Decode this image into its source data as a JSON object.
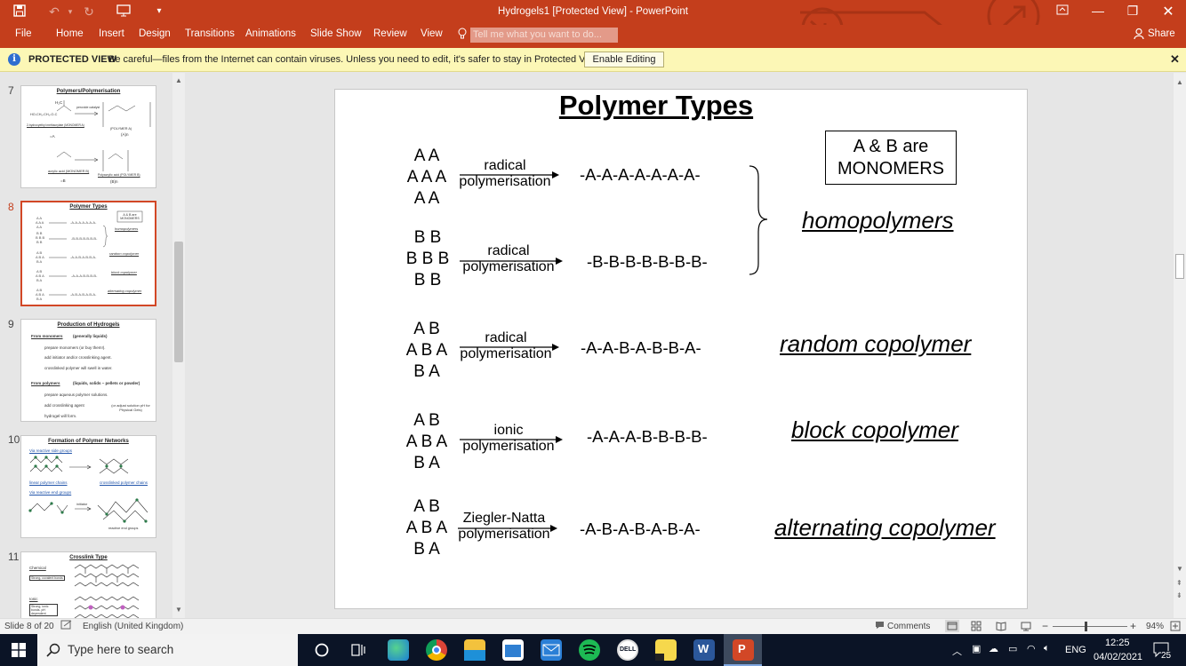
{
  "window": {
    "title": "Hydrogels1 [Protected View] - PowerPoint",
    "share_label": "Share"
  },
  "ribbon": {
    "tabs": [
      "File",
      "Home",
      "Insert",
      "Design",
      "Transitions",
      "Animations",
      "Slide Show",
      "Review",
      "View"
    ],
    "tell_me_placeholder": "Tell me what you want to do..."
  },
  "protected_view": {
    "title": "PROTECTED VIEW",
    "message": "Be careful—files from the Internet can contain viruses. Unless you need to edit, it's safer to stay in Protected View.",
    "enable_label": "Enable Editing"
  },
  "thumbnails": [
    {
      "number": "7",
      "title": "Polymers/Polymerisation"
    },
    {
      "number": "8",
      "title": "Polymer Types",
      "selected": true
    },
    {
      "number": "9",
      "title": "Production of Hydrogels"
    },
    {
      "number": "10",
      "title": "Formation of Polymer Networks"
    },
    {
      "number": "11",
      "title": "Crosslink Type"
    }
  ],
  "thumb_text": {
    "t7": [
      "H₂C",
      "peroxide catalyst",
      "HO-CH₂-CH₂-O-C",
      "2-hydroxyethyl methacrylate (MONOMER A)",
      "=A",
      "(POLYMER A)",
      "(A)n",
      "acrylic acid (MONOMER B)",
      "=B",
      "Polyacrylic acid (POLYMER B)",
      "(B)n"
    ],
    "t8": [
      "A & B are MONOMERS",
      "homopolymers",
      "random copolymer",
      "block copolymer",
      "alternating copolymer"
    ],
    "t9": [
      "From monomers",
      "(generally liquids)",
      "prepare monomers (or buy them!).",
      "add initiator and/or crosslinking agent.",
      "crosslinked polymer will swell in water.",
      "From polymers",
      "(liquids, solids – pellets or powder)",
      "prepare aqueous polymer solutions.",
      "add crosslinking agent",
      "hydrogel will form.",
      "(or adjust solution pH for Physical Gels)"
    ],
    "t10": [
      "Via reactive side groups",
      "linear polymer chains",
      "crosslinked polymer chains",
      "Via reactive end groups",
      "initiator",
      "reactive end groups"
    ],
    "t11": [
      "Chemical",
      "Strong, covalent bonds",
      "Ionic",
      "Strong, ionic bonds. pH dependent"
    ]
  },
  "slide": {
    "title": "Polymer Types",
    "monomer_note": "A & B are\nMONOMERS",
    "rows": [
      {
        "monomers": [
          "A A",
          "A A A",
          "A A"
        ],
        "process": [
          "radical",
          "polymerisation"
        ],
        "chain": "-A-A-A-A-A-A-A-"
      },
      {
        "monomers": [
          "B B",
          "B B B",
          "B B"
        ],
        "process": [
          "radical",
          "polymerisation"
        ],
        "chain": "-B-B-B-B-B-B-B-"
      },
      {
        "monomers": [
          "A B",
          "A B A",
          "B A"
        ],
        "process": [
          "radical",
          "polymerisation"
        ],
        "chain": "-A-A-B-A-B-B-A-",
        "type": "random copolymer"
      },
      {
        "monomers": [
          "A B",
          "A B A",
          "B A"
        ],
        "process": [
          "ionic",
          "polymerisation"
        ],
        "chain": "-A-A-A-B-B-B-B-",
        "type": "block copolymer"
      },
      {
        "monomers": [
          "A B",
          "A B A",
          "B A"
        ],
        "process": [
          "Ziegler-Natta",
          "polymerisation"
        ],
        "chain": "-A-B-A-B-A-B-A-",
        "type": "alternating copolymer"
      }
    ],
    "homopolymers_label": "homopolymers"
  },
  "status": {
    "slide_info": "Slide 8 of 20",
    "language": "English (United Kingdom)",
    "comments": "Comments",
    "zoom": "94%"
  },
  "taskbar": {
    "search_placeholder": "Type here to search",
    "language": "ENG",
    "time": "12:25",
    "date": "04/02/2021",
    "notifications": "25"
  },
  "colors": {
    "accent": "#c43e1c",
    "selected_border": "#d24726",
    "protected_bg": "#fcf7b6",
    "taskbar": "#0b1426"
  }
}
